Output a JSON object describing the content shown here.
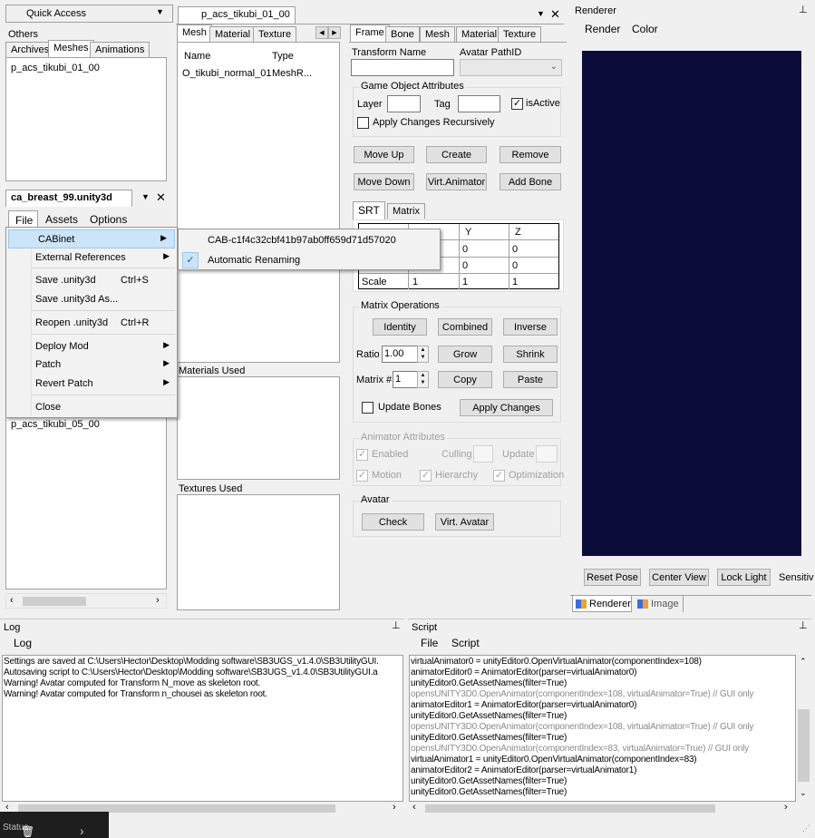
{
  "quick_access": {
    "title": "Quick Access",
    "tabs": [
      "Others",
      "Archives",
      "Meshes",
      "Animations"
    ],
    "items": [
      "p_acs_tikubi_01_00"
    ]
  },
  "unity_doc": {
    "title": "ca_breast_99.unity3d",
    "menu": [
      "File",
      "Assets",
      "Options"
    ],
    "list_item": "p_acs_tikubi_05_00"
  },
  "file_menu": {
    "items": [
      {
        "label": "CABinet",
        "has_sub": true
      },
      {
        "label": "External References",
        "has_sub": true
      },
      {
        "label": "Save .unity3d",
        "shortcut": "Ctrl+S"
      },
      {
        "label": "Save .unity3d As..."
      },
      {
        "label": "Reopen .unity3d",
        "shortcut": "Ctrl+R"
      },
      {
        "label": "Deploy Mod",
        "has_sub": true
      },
      {
        "label": "Patch",
        "has_sub": true
      },
      {
        "label": "Revert Patch",
        "has_sub": true
      },
      {
        "label": "Close"
      }
    ],
    "sub": [
      {
        "label": "CAB-c1f4c32cbf41b97ab0ff659d71d57020",
        "checked": false
      },
      {
        "label": "Automatic Renaming",
        "checked": true
      }
    ]
  },
  "editor": {
    "title": "p_acs_tikubi_01_00",
    "tabs": [
      "Mesh",
      "Material",
      "Texture"
    ],
    "mesh_headers": [
      "Name",
      "Type"
    ],
    "mesh_rows": [
      [
        "O_tikubi_normal_01",
        "MeshR..."
      ]
    ],
    "materials_label": "Materials Used",
    "textures_label": "Textures Used"
  },
  "frame": {
    "tabs": [
      "Frame",
      "Bone",
      "Mesh",
      "Material",
      "Texture"
    ],
    "transform_name_label": "Transform Name",
    "avatar_path_label": "Avatar PathID",
    "goa": {
      "caption": "Game Object Attributes",
      "layer": "Layer",
      "tag": "Tag",
      "is_active": "isActive",
      "apply_rec": "Apply Changes Recursively"
    },
    "buttons_row1": [
      "Move Up",
      "Create",
      "Remove"
    ],
    "buttons_row2": [
      "Move Down",
      "Virt.Animator",
      "Add Bone"
    ],
    "srt_tabs": [
      "SRT",
      "Matrix"
    ],
    "srt_headers": [
      "Y",
      "Z"
    ],
    "srt_rows": [
      [
        "0",
        "0"
      ],
      [
        "0",
        "0"
      ]
    ],
    "scale_row": [
      "Scale",
      "1",
      "1",
      "1"
    ],
    "matrix_ops": {
      "caption": "Matrix Operations",
      "buttons": [
        "Identity",
        "Combined",
        "Inverse"
      ],
      "ratio_label": "Ratio",
      "ratio_value": "1.00",
      "grow": "Grow",
      "shrink": "Shrink",
      "matrix_label": "Matrix #",
      "matrix_value": "1",
      "copy": "Copy",
      "paste": "Paste",
      "update_bones": "Update Bones",
      "apply": "Apply Changes"
    },
    "animator": {
      "caption": "Animator Attributes",
      "enabled": "Enabled",
      "culling": "Culling",
      "update": "Update",
      "motion": "Motion",
      "hierarchy": "Hierarchy",
      "optimization": "Optimization"
    },
    "avatar": {
      "caption": "Avatar",
      "check": "Check",
      "virt": "Virt. Avatar"
    }
  },
  "renderer": {
    "title": "Renderer",
    "menu": [
      "Render",
      "Color"
    ],
    "viewport_color": "#0b0c3a",
    "buttons": [
      "Reset Pose",
      "Center View",
      "Lock Light"
    ],
    "sensitivity": "Sensitiv",
    "bottom_tabs": [
      "Renderer",
      "Image"
    ]
  },
  "log": {
    "title": "Log",
    "menu": [
      "Log"
    ],
    "lines": [
      "Settings are saved at C:\\Users\\Hector\\Desktop\\Modding software\\SB3UGS_v1.4.0\\SB3UtilityGUI.",
      "Autosaving script to C:\\Users\\Hector\\Desktop\\Modding software\\SB3UGS_v1.4.0\\SB3UtilityGUI.a",
      "Warning! Avatar computed for Transform N_move as skeleton root.",
      "Warning! Avatar computed for Transform n_chousei as skeleton root."
    ]
  },
  "script": {
    "title": "Script",
    "menu": [
      "File",
      "Script"
    ],
    "lines": [
      {
        "text": "virtualAnimator0 = unityEditor0.OpenVirtualAnimator(componentIndex=108)",
        "gray": false
      },
      {
        "text": "animatorEditor0 = AnimatorEditor(parser=virtualAnimator0)",
        "gray": false
      },
      {
        "text": "unityEditor0.GetAssetNames(filter=True)",
        "gray": false
      },
      {
        "text": "opensUNITY3D0.OpenAnimator(componentIndex=108, virtualAnimator=True) // GUI only",
        "gray": true
      },
      {
        "text": "animatorEditor1 = AnimatorEditor(parser=virtualAnimator0)",
        "gray": false
      },
      {
        "text": "unityEditor0.GetAssetNames(filter=True)",
        "gray": false
      },
      {
        "text": "opensUNITY3D0.OpenAnimator(componentIndex=108, virtualAnimator=True) // GUI only",
        "gray": true
      },
      {
        "text": "unityEditor0.GetAssetNames(filter=True)",
        "gray": false
      },
      {
        "text": "opensUNITY3D0.OpenAnimator(componentIndex=83, virtualAnimator=True) // GUI only",
        "gray": true
      },
      {
        "text": "virtualAnimator1 = unityEditor0.OpenVirtualAnimator(componentIndex=83)",
        "gray": false
      },
      {
        "text": "animatorEditor2 = AnimatorEditor(parser=virtualAnimator1)",
        "gray": false
      },
      {
        "text": "unityEditor0.GetAssetNames(filter=True)",
        "gray": false
      },
      {
        "text": "unityEditor0.GetAssetNames(filter=True)",
        "gray": false
      }
    ]
  },
  "status": {
    "label": "Status"
  }
}
